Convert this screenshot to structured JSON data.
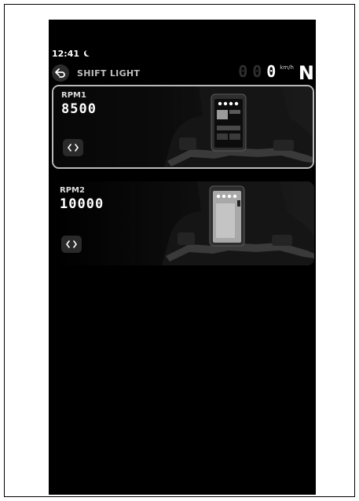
{
  "status": {
    "time": "12:41",
    "icon": "moon-icon"
  },
  "header": {
    "back_icon": "back-arrow-icon",
    "title": "SHIFT LIGHT",
    "speed_digits": [
      "0",
      "0",
      "0"
    ],
    "speed_unit": "km/h",
    "gear": "N"
  },
  "cards": [
    {
      "label": "RPM1",
      "value": "8500",
      "selected": true,
      "button_icon": "code-brackets-icon"
    },
    {
      "label": "RPM2",
      "value": "10000",
      "selected": false,
      "button_icon": "code-brackets-icon"
    }
  ],
  "colors": {
    "background": "#000000",
    "accent": "#ffffff",
    "selected_border": "#b9b9b9"
  }
}
